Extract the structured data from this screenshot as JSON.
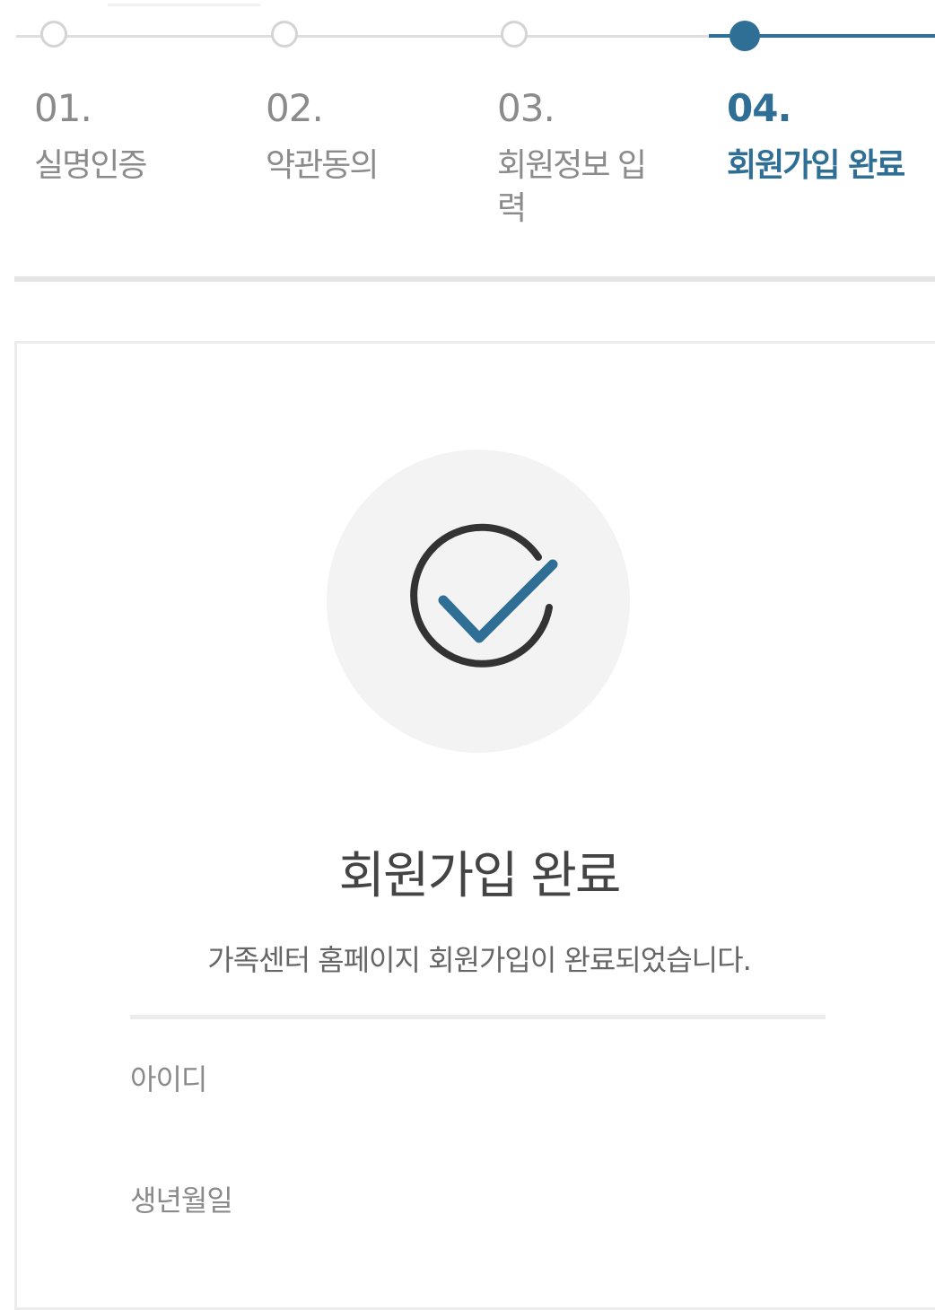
{
  "steps": [
    {
      "num": "01.",
      "label": "실명인증",
      "active": false
    },
    {
      "num": "02.",
      "label": "약관동의",
      "active": false
    },
    {
      "num": "03.",
      "label": "회원정보 입력",
      "active": false
    },
    {
      "num": "04.",
      "label": "회원가입 완료",
      "active": true
    }
  ],
  "completion": {
    "icon": "check-circle-icon",
    "title": "회원가입 완료",
    "message": "가족센터 홈페이지 회원가입이 완료되었습니다."
  },
  "info_rows": [
    {
      "label": "아이디"
    },
    {
      "label": "생년월일"
    }
  ],
  "colors": {
    "accent": "#2f6f95",
    "inactive": "#8b8b8b",
    "check_ring": "#333333"
  }
}
